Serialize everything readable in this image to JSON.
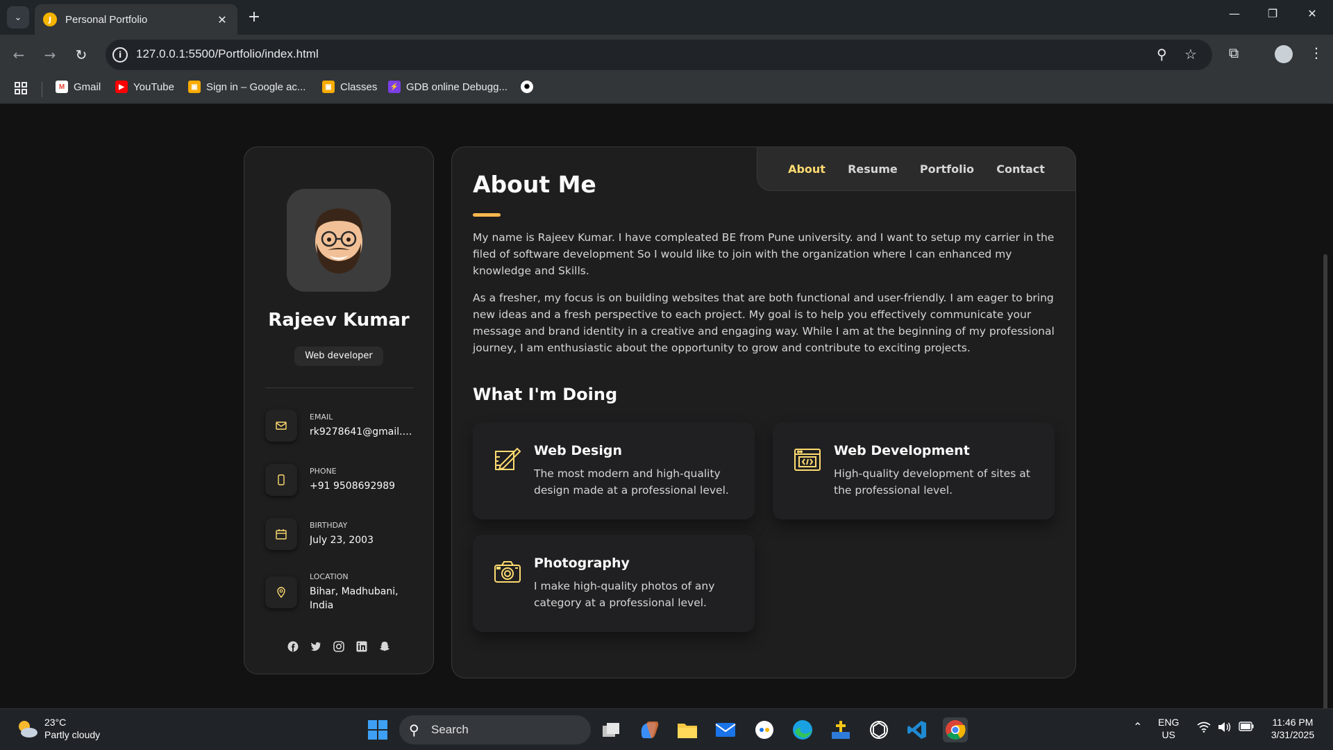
{
  "browser": {
    "tab_title": "Personal Portfolio",
    "tab_favicon_letter": "J",
    "url": "127.0.0.1:5500/Portfolio/index.html",
    "bookmarks": [
      "Gmail",
      "YouTube",
      "Sign in – Google ac...",
      "Classes",
      "GDB online Debugg..."
    ]
  },
  "sidebar": {
    "name": "Rajeev Kumar",
    "role": "Web developer",
    "contacts": [
      {
        "label": "Email",
        "value": "rk9278641@gmail.co...",
        "icon": "mail-icon"
      },
      {
        "label": "Phone",
        "value": "+91 9508692989",
        "icon": "phone-icon"
      },
      {
        "label": "Birthday",
        "value": "July 23, 2003",
        "icon": "calendar-icon"
      },
      {
        "label": "Location",
        "value": "Bihar, Madhubani, India",
        "icon": "location-icon"
      }
    ],
    "social": [
      "facebook-icon",
      "twitter-icon",
      "instagram-icon",
      "linkedin-icon",
      "snapchat-icon"
    ]
  },
  "navbar": {
    "items": [
      "About",
      "Resume",
      "Portfolio",
      "Contact"
    ],
    "active": "About"
  },
  "about": {
    "title": "About Me",
    "para1": "My name is Rajeev Kumar. I have compleated BE from Pune university. and I want to setup my carrier in the filed of software development So I would like to join with the organization where I can enhanced my knowledge and Skills.",
    "para2": "As a fresher, my focus is on building websites that are both functional and user-friendly. I am eager to bring new ideas and a fresh perspective to each project. My goal is to help you effectively communicate your message and brand identity in a creative and engaging way. While I am at the beginning of my professional journey, I am enthusiastic about the opportunity to grow and contribute to exciting projects.",
    "services_title": "What I'm Doing",
    "services": [
      {
        "title": "Web Design",
        "text": "The most modern and high-quality design made at a professional level.",
        "icon": "design-icon"
      },
      {
        "title": "Web Development",
        "text": "High-quality development of sites at the professional level.",
        "icon": "dev-icon"
      },
      {
        "title": "Photography",
        "text": "I make high-quality photos of any category at a professional level.",
        "icon": "camera-icon"
      }
    ]
  },
  "taskbar": {
    "temp": "23°C",
    "weather": "Partly cloudy",
    "search_label": "Search",
    "lang": "ENG",
    "region": "US",
    "time": "11:46 PM",
    "date": "3/31/2025"
  },
  "colors": {
    "accent": "#ffdb70",
    "accent_bar": "#ffb84d",
    "card_bg": "#1e1e1f",
    "page_bg": "#121212"
  }
}
